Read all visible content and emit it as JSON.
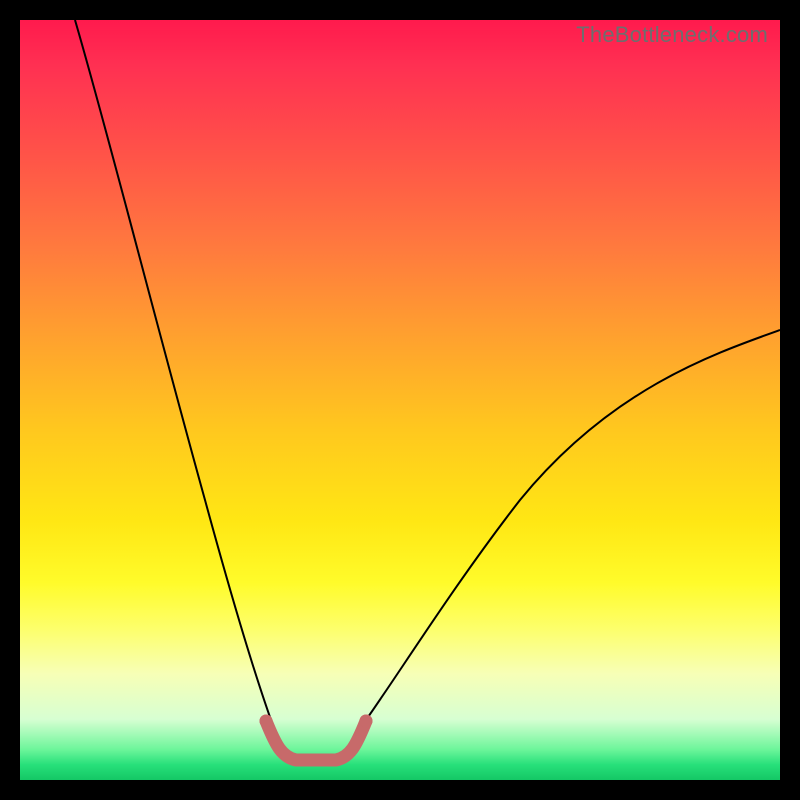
{
  "watermark": "TheBottleneck.com",
  "chart_data": {
    "type": "line",
    "title": "",
    "xlabel": "",
    "ylabel": "",
    "xlim": [
      0,
      100
    ],
    "ylim": [
      0,
      100
    ],
    "grid": false,
    "legend": false,
    "background_gradient": {
      "orientation": "vertical",
      "stops": [
        {
          "pos": 0,
          "color": "#ff1a4d"
        },
        {
          "pos": 18,
          "color": "#ff5448"
        },
        {
          "pos": 42,
          "color": "#ffa22e"
        },
        {
          "pos": 66,
          "color": "#ffe714"
        },
        {
          "pos": 86,
          "color": "#f7ffb6"
        },
        {
          "pos": 100,
          "color": "#14c765"
        }
      ]
    },
    "series": [
      {
        "name": "bottleneck_curve_left",
        "stroke": "#000000",
        "stroke_width": 2,
        "x": [
          7,
          10,
          13,
          16,
          19,
          22,
          25,
          28,
          30,
          32,
          34
        ],
        "y": [
          100,
          88,
          76,
          64,
          53,
          42,
          32,
          22,
          14,
          8,
          4
        ]
      },
      {
        "name": "bottleneck_curve_right",
        "stroke": "#000000",
        "stroke_width": 2,
        "x": [
          44,
          48,
          53,
          59,
          66,
          74,
          83,
          92,
          100
        ],
        "y": [
          4,
          8,
          14,
          22,
          30,
          38,
          46,
          53,
          59
        ]
      },
      {
        "name": "trough_highlight",
        "stroke": "#c76a6a",
        "stroke_width": 11,
        "linecap": "round",
        "x": [
          32,
          34,
          36,
          38,
          40,
          42,
          44
        ],
        "y": [
          7,
          3.5,
          2.5,
          2.5,
          2.5,
          3.5,
          7
        ]
      }
    ],
    "annotations": [
      {
        "text": "TheBottleneck.com",
        "position": "top-right",
        "color": "#6e6e6e"
      }
    ]
  }
}
